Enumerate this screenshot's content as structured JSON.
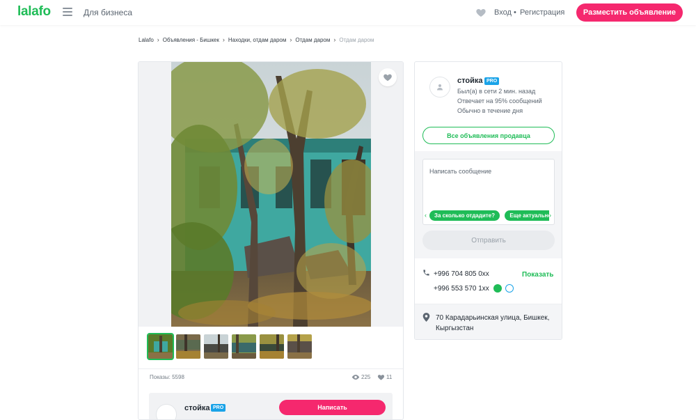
{
  "header": {
    "logo": "lalafo",
    "business_link": "Для бизнеса",
    "login": "Вход",
    "separator": "•",
    "register": "Регистрация",
    "post_button": "Разместить объявление"
  },
  "breadcrumbs": {
    "items": [
      "Lalafo",
      "Объявления - Бишкек",
      "Находки, отдам даром",
      "Отдам даром"
    ],
    "current": "Отдам даром",
    "separator": "›"
  },
  "gallery": {
    "thumbnail_count": 6,
    "active_thumbnail": 1,
    "views_label": "Показы: 5598",
    "eye_count": "225",
    "likes_count": "11"
  },
  "seller_strip": {
    "name": "стойка",
    "badge": "PRO",
    "write_button": "Написать"
  },
  "seller": {
    "name": "стойка",
    "badge": "PRO",
    "last_seen": "Был(а) в сети 2 мин. назад",
    "response_rate": "Отвечает на 95% сообщений",
    "response_time": "Обычно в течение дня",
    "all_ads_button": "Все объявления продавца"
  },
  "message": {
    "placeholder": "Написать сообщение",
    "quick_replies": [
      "За сколько отдадите?",
      "Еще актуально?"
    ],
    "send_button": "Отправить"
  },
  "contacts": {
    "phone1": "+996 704 805 0xx",
    "phone2": "+996 553 570 1xx",
    "show_link": "Показать"
  },
  "location": {
    "address": "70 Карадарьинская улица, Бишкек, Кыргызстан"
  },
  "colors": {
    "brand_green": "#1fbc57",
    "accent_pink": "#f5286e",
    "pro_blue": "#1aa3e8"
  }
}
